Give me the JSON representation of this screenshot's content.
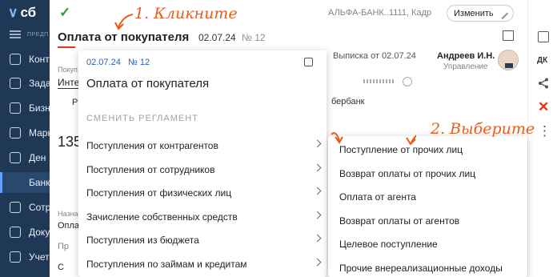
{
  "sidebar": {
    "logo": "сб",
    "section_label": "ПРЕДП",
    "items": [
      {
        "label": "Конт",
        "icon": "contacts-icon"
      },
      {
        "label": "Зада",
        "icon": "tasks-icon"
      },
      {
        "label": "Бизн",
        "icon": "business-icon"
      },
      {
        "label": "Марк",
        "icon": "marketing-icon"
      },
      {
        "label": "Ден",
        "icon": "money-icon"
      },
      {
        "label": "Банк",
        "icon": "bank-icon"
      },
      {
        "label": "Сотр",
        "icon": "staff-icon"
      },
      {
        "label": "Доку",
        "icon": "documents-icon"
      },
      {
        "label": "Учет",
        "icon": "accounting-icon"
      }
    ]
  },
  "header": {
    "bank_info": "АЛЬФА-БАНК..1111, Кадр",
    "change_button": "Изменить",
    "doc_title": "Оплата от покупателя",
    "doc_date": "02.07.24",
    "doc_number": "№ 12"
  },
  "annotations": {
    "step1": "1. Кликните",
    "step2": "2. Выберите",
    "color": "#e85c1b"
  },
  "background": {
    "statement": "Выписка от 02.07.24",
    "employee_name": "Андреев И.Н.",
    "employee_role": "Управление",
    "payer_label": "Покуп",
    "payer_value": "Инте",
    "bank_name": "бербанк",
    "r_letter": "Р",
    "amount": "135",
    "purpose_label": "Назна",
    "purpose_value": "Оплата",
    "link1": "Пр",
    "link2": "С"
  },
  "popup": {
    "date": "02.07.24",
    "number": "№ 12",
    "title": "Оплата от покупателя",
    "section": "СМЕНИТЬ РЕГЛАМЕНТ",
    "items": [
      "Поступления от контрагентов",
      "Поступления от сотрудников",
      "Поступления от физических лиц",
      "Зачисление собственных средств",
      "Поступления из бюджета",
      "Поступления по займам и кредитам"
    ]
  },
  "submenu": {
    "items": [
      "Поступление от прочих лиц",
      "Возврат оплаты от прочих лиц",
      "Оплата от агента",
      "Возврат оплаты от агентов",
      "Целевое поступление",
      "Прочие внереализационные доходы"
    ]
  },
  "rightbar": {
    "dk_label": "ДК"
  },
  "colors": {
    "sidebar_bg": "#1f3856",
    "accent_blue": "#2b5fa6",
    "check_green": "#2e9b3c",
    "delete_red": "#e5331c"
  }
}
